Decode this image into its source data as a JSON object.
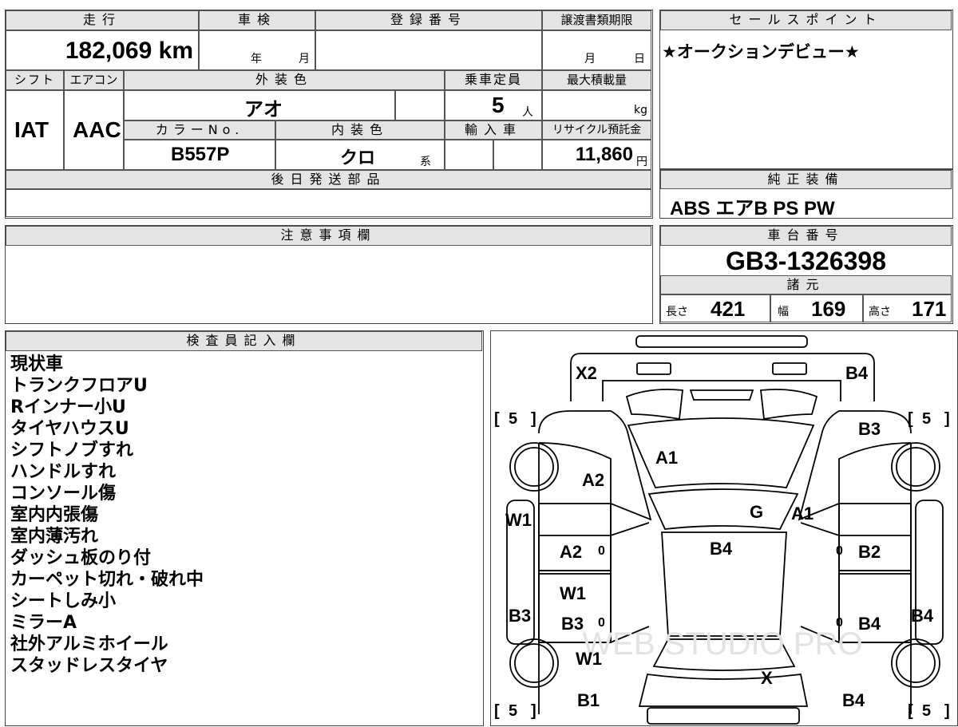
{
  "header": {
    "mileage_label": "走行",
    "mileage_value": "182,069",
    "mileage_unit": "km",
    "inspection_label": "車検",
    "inspection_year": "年",
    "inspection_month": "月",
    "registration_label": "登録番号",
    "transfer_label": "譲渡書類期限",
    "transfer_month": "月",
    "transfer_day": "日",
    "shift_label": "シフト",
    "shift_value": "IAT",
    "ac_label": "エアコン",
    "ac_value": "AAC",
    "exterior_label": "外装色",
    "exterior_value": "アオ",
    "capacity_label": "乗車定員",
    "capacity_value": "5",
    "capacity_unit": "人",
    "load_label": "最大積載量",
    "load_unit": "kg",
    "colorno_label": "カラーNo.",
    "colorno_value": "B557P",
    "interior_label": "内装色",
    "interior_value": "クロ",
    "interior_suffix": "系",
    "import_label": "輸入車",
    "recycle_label": "リサイクル預託金",
    "recycle_value": "11,860",
    "recycle_unit": "円",
    "later_parts_label": "後日発送部品"
  },
  "sales": {
    "label": "セールスポイント",
    "text": "★オークションデビュー★"
  },
  "equipment": {
    "label": "純正装備",
    "items": "ABS エアB PS PW"
  },
  "caution": {
    "label": "注意事項欄"
  },
  "chassis": {
    "label": "車台番号",
    "value": "GB3-1326398",
    "spec_label": "諸元",
    "length_label": "長さ",
    "length_value": "421",
    "width_label": "幅",
    "width_value": "169",
    "height_label": "高さ",
    "height_value": "171"
  },
  "inspector": {
    "label": "検査員記入欄",
    "notes": [
      "現状車",
      "トランクフロアU",
      "Rインナー小U",
      "タイヤハウスU",
      "シフトノブすれ",
      "ハンドルすれ",
      "コンソール傷",
      "室内内張傷",
      "室内薄汚れ",
      "ダッシュ板のり付",
      "カーペット切れ・破れ中",
      "シートしみ小",
      "ミラーA",
      "社外アルミホイール",
      "スタッドレスタイヤ"
    ]
  },
  "diagram": {
    "watermark": "WEB STUDIO PRO",
    "labels": {
      "x2": "X2",
      "b4_top": "B4",
      "a1_top": "A1",
      "a2_left": "A2",
      "b3_tr": "B3",
      "g": "G",
      "a1_right": "A1",
      "w1_left": "W1",
      "a2_mid": "A2",
      "b4_center": "B4",
      "b2": "B2",
      "w1_mid": "W1",
      "b3_left": "B3",
      "b3_mid": "B3",
      "b4_mid_right": "B4",
      "b4_right": "B4",
      "w1_low": "W1",
      "x": "X",
      "b1": "B1",
      "b4_bottom": "B4",
      "tire_tl": "5",
      "tire_tr": "5",
      "tire_bl": "5",
      "tire_br": "5",
      "zero": "0"
    }
  }
}
